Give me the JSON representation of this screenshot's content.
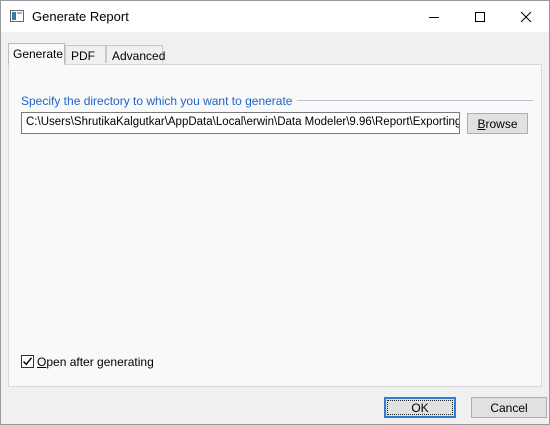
{
  "window": {
    "title": "Generate Report"
  },
  "tabs": [
    {
      "label": "Generate",
      "active": true
    },
    {
      "label": "PDF",
      "active": false
    },
    {
      "label": "Advanced",
      "active": false
    }
  ],
  "generate": {
    "group_label": "Specify the directory to which you want to generate",
    "directory_value": "C:\\Users\\ShrutikaKalgutkar\\AppData\\Local\\erwin\\Data Modeler\\9.96\\Report\\Exporting",
    "browse_label_accel": "B",
    "browse_label_rest": "rowse",
    "open_after_label_accel": "O",
    "open_after_label_rest": "pen after generating",
    "open_after_checked": true
  },
  "buttons": {
    "ok_label": "OK",
    "cancel_label": "Cancel"
  },
  "colors": {
    "accent": "#1f64c8",
    "default_button_border": "#2c7cd6"
  },
  "icons": {
    "app": "report-window-icon",
    "minimize": "minimize-icon",
    "maximize": "maximize-icon",
    "close": "close-icon",
    "check": "checkmark-icon"
  }
}
